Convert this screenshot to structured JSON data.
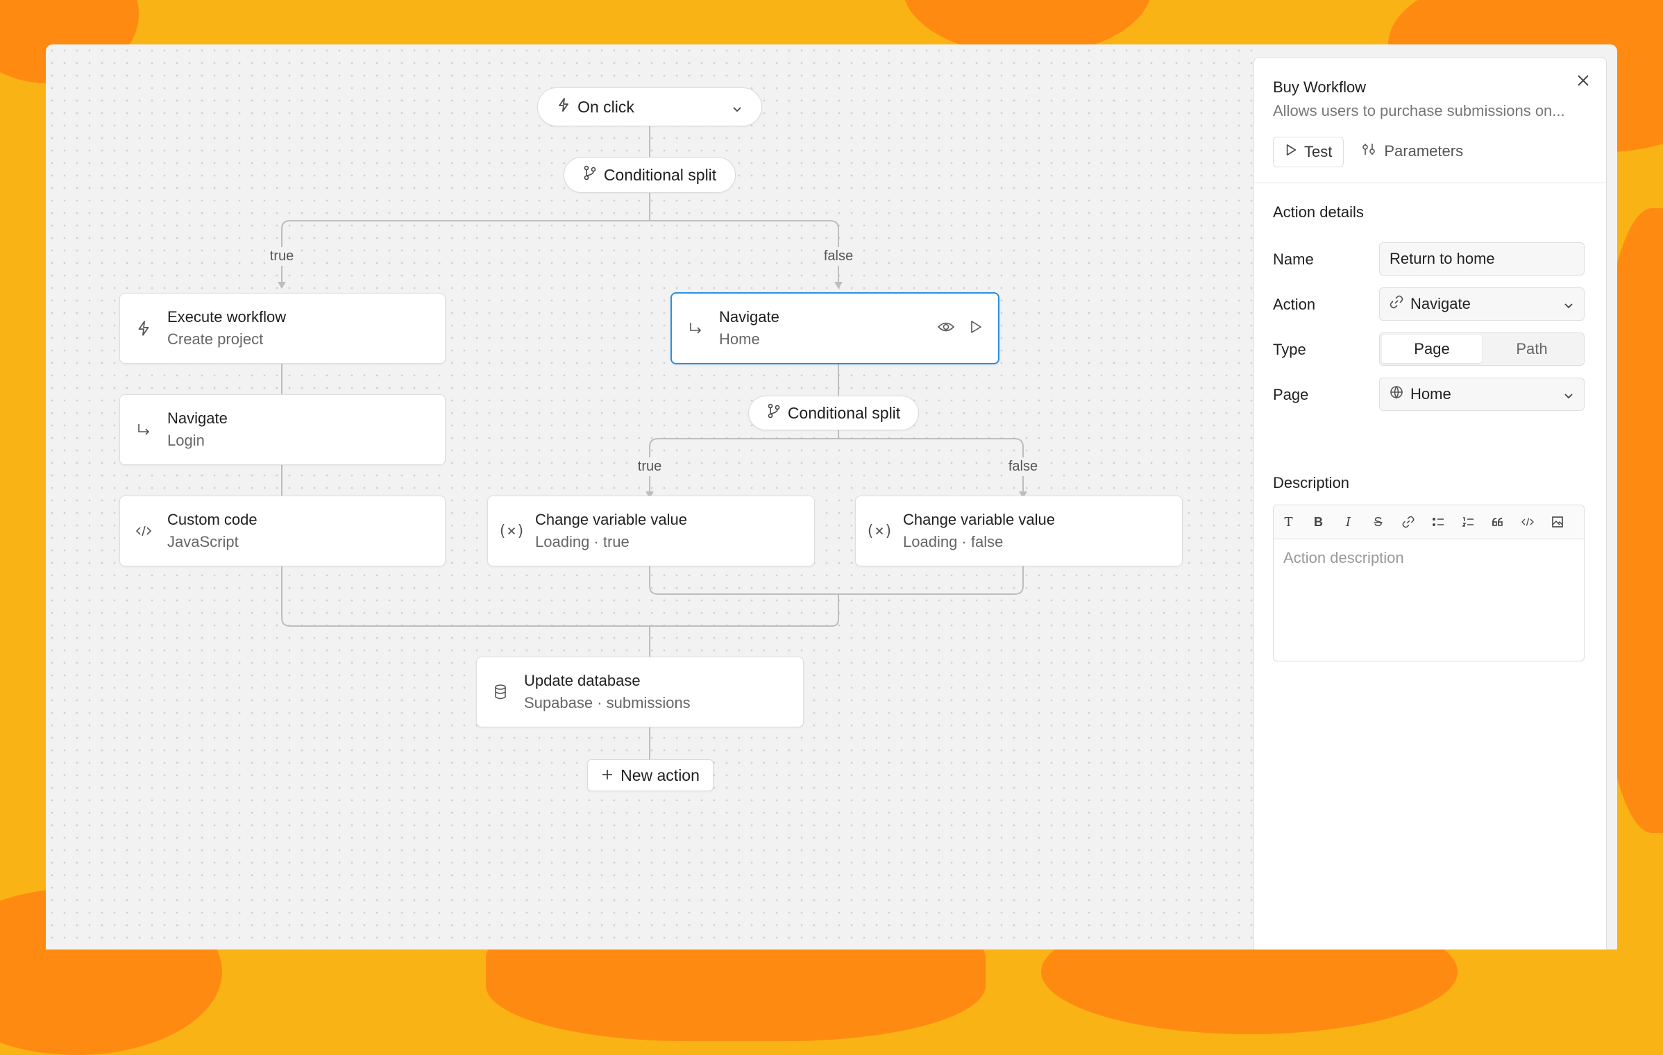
{
  "canvas": {
    "trigger": {
      "label": "On click"
    },
    "splits": [
      {
        "label": "Conditional split"
      },
      {
        "label": "Conditional split"
      }
    ],
    "edge_labels": [
      "true",
      "false",
      "true",
      "false"
    ],
    "nodes": [
      {
        "title": "Execute workflow",
        "subtitle": "Create project",
        "icon": "lightning-icon"
      },
      {
        "title": "Navigate",
        "subtitle": "Login",
        "icon": "arrow-corner-icon"
      },
      {
        "title": "Custom code",
        "subtitle": "JavaScript",
        "icon": "code-icon"
      },
      {
        "title": "Navigate",
        "subtitle": "Home",
        "icon": "arrow-corner-icon",
        "selected": true
      },
      {
        "title": "Change variable value",
        "subtitle": "Loading · true",
        "icon": "variable-icon"
      },
      {
        "title": "Change variable value",
        "subtitle": "Loading · false",
        "icon": "variable-icon"
      },
      {
        "title": "Update database",
        "subtitle": "Supabase · submissions",
        "icon": "database-icon"
      }
    ],
    "new_action": {
      "label": "New action"
    }
  },
  "panel": {
    "title": "Buy Workflow",
    "subtitle": "Allows users to purchase submissions on...",
    "tabs": [
      {
        "label": "Test"
      },
      {
        "label": "Parameters"
      }
    ],
    "section": "Action details",
    "fields": {
      "name": {
        "label": "Name",
        "value": "Return to home"
      },
      "action": {
        "label": "Action",
        "value": "Navigate"
      },
      "type": {
        "label": "Type",
        "options": [
          "Page",
          "Path"
        ],
        "selected": "Page"
      },
      "page": {
        "label": "Page",
        "value": "Home"
      }
    },
    "description": {
      "label": "Description",
      "placeholder": "Action description"
    },
    "toolbar": [
      "text-icon",
      "bold-icon",
      "italic-icon",
      "strikethrough-icon",
      "link-icon",
      "bullet-list-icon",
      "numbered-list-icon",
      "quote-icon",
      "code-icon",
      "image-icon"
    ]
  },
  "colors": {
    "background": "#f9b315",
    "blob": "#ff8a12",
    "selected_border": "#2a8fe0"
  }
}
